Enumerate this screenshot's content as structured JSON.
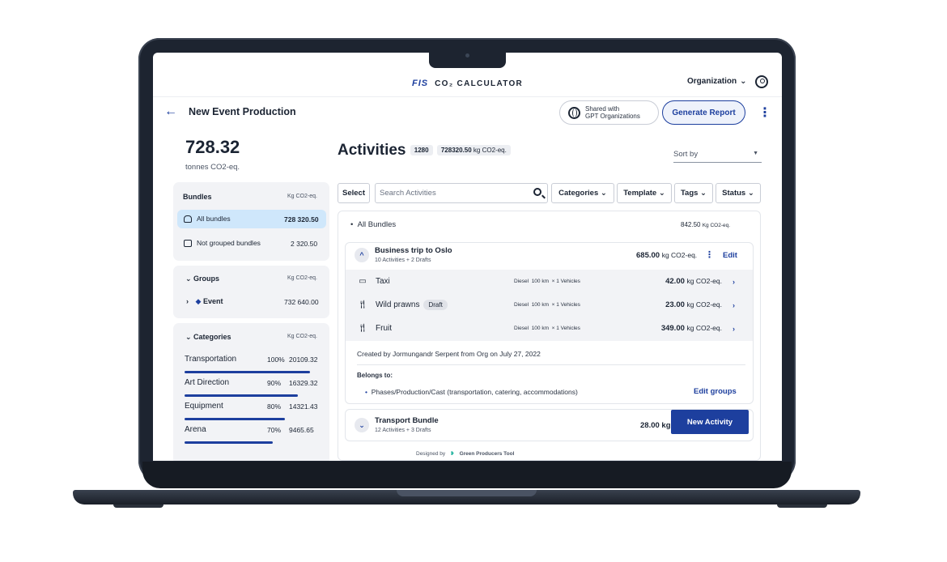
{
  "header": {
    "logo_text": "FIS",
    "app_title": "CO₂ CALCULATOR",
    "org_menu": "Organization",
    "org_chevron": "⌄"
  },
  "page": {
    "back": "←",
    "title": "New Event Production",
    "shared": [
      "Shared with",
      "GPT Organizations"
    ],
    "generate_report": "Generate Report",
    "more": "⋮"
  },
  "summary": {
    "value": "728.32",
    "unit": "tonnes CO2-eq."
  },
  "bundles": {
    "heading": "Bundles",
    "unit": "Kg CO2-eq.",
    "items": [
      {
        "label": "All bundles",
        "value": "728 320.50"
      },
      {
        "label": "Not grouped bundles",
        "value": "2 320.50"
      }
    ]
  },
  "groups": {
    "heading": "Groups",
    "unit": "Kg CO2-eq.",
    "items": [
      {
        "label": "Event",
        "value": "732 640.00"
      }
    ]
  },
  "categories": {
    "heading": "Categories",
    "unit": "Kg CO2-eq.",
    "items": [
      {
        "label": "Transportation",
        "pct": "100%",
        "value": "20109.32",
        "fill": 1.0
      },
      {
        "label": "Art Direction",
        "pct": "90%",
        "value": "16329.32",
        "fill": 0.9
      },
      {
        "label": "Equipment",
        "pct": "80%",
        "value": "14321.43",
        "fill": 0.8
      },
      {
        "label": "Arena",
        "pct": "70%",
        "value": "9465.65",
        "fill": 0.7
      }
    ]
  },
  "activities": {
    "title": "Activities",
    "count": "1280",
    "total": "728320.50",
    "total_unit": "kg CO2-eq.",
    "sort_by": "Sort by",
    "select": "Select",
    "search_placeholder": "Search Activities",
    "filters": [
      "Categories",
      "Template",
      "Tags",
      "Status"
    ],
    "all_bundles": "All Bundles",
    "all_bundles_total": "842.50",
    "all_bundles_unit": "Kg CO2-eq."
  },
  "bundle1": {
    "title": "Business trip to Oslo",
    "sub": "10 Activities + 2 Drafts",
    "total": "685.00",
    "unit": "kg CO2-eq.",
    "edit": "Edit",
    "rows": [
      {
        "icon": "taxi-icon",
        "name": "Taxi",
        "draft": "",
        "fuel": "Diesel",
        "dist": "100 km",
        "veh": "× 1 Vehicles",
        "value": "42.00",
        "unit": "kg CO2-eq."
      },
      {
        "icon": "food-icon",
        "name": "Wild prawns",
        "draft": "Draft",
        "fuel": "Diesel",
        "dist": "100 km",
        "veh": "× 1 Vehicles",
        "value": "23.00",
        "unit": "kg CO2-eq."
      },
      {
        "icon": "food-icon",
        "name": "Fruit",
        "draft": "",
        "fuel": "Diesel",
        "dist": "100 km",
        "veh": "× 1 Vehicles",
        "value": "349.00",
        "unit": "kg CO2-eq."
      }
    ],
    "created": "Created by Jormungandr Serpent from Org on July 27, 2022",
    "belongs_label": "Belongs to:",
    "belongs": "Phases/Production/Cast (transportation, catering, accommodations)",
    "edit_groups": "Edit groups"
  },
  "bundle2": {
    "title": "Transport Bundle",
    "sub": "12 Activities + 3 Drafts",
    "total_partial": "28.00 kg"
  },
  "new_activity": "New Activity",
  "footer": {
    "designed_by": "Designed by",
    "brand": "Green Producers Tool"
  },
  "colors": {
    "accent": "#1d3f9e",
    "highlight": "#cfe7fb",
    "panel": "#f2f3f6"
  }
}
